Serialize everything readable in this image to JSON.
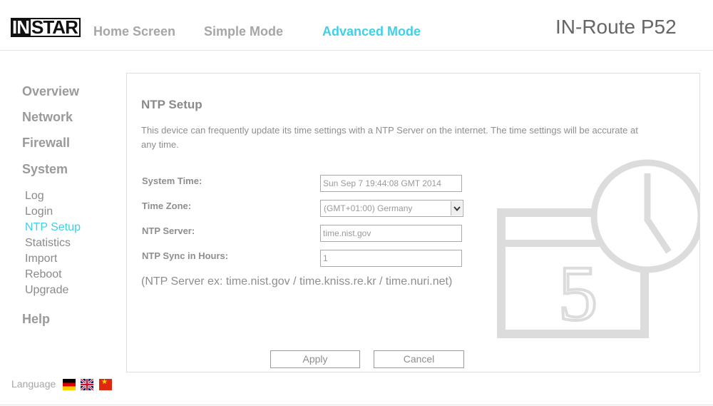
{
  "brand": {
    "logo_left": "IN",
    "logo_right": "STAR"
  },
  "topnav": {
    "home": "Home Screen",
    "simple": "Simple Mode",
    "advanced": "Advanced Mode"
  },
  "model": "IN-Route P52",
  "sidebar": {
    "overview": "Overview",
    "network": "Network",
    "firewall": "Firewall",
    "system": "System",
    "help": "Help",
    "sub": {
      "log": "Log",
      "login": "Login",
      "ntp": "NTP Setup",
      "statistics": "Statistics",
      "import": "Import",
      "reboot": "Reboot",
      "upgrade": "Upgrade"
    }
  },
  "language": {
    "label": "Language"
  },
  "panel": {
    "title": "NTP Setup",
    "description": "This device can frequently update its time settings with a NTP Server on the internet. The time settings will be accurate at any time.",
    "fields": {
      "system_time": {
        "label": "System Time:",
        "value": "Sun Sep  7 19:44:08 GMT 2014"
      },
      "time_zone": {
        "label": "Time Zone:",
        "value": "(GMT+01:00) Germany"
      },
      "ntp_server": {
        "label": "NTP Server:",
        "value": "time.nist.gov"
      },
      "ntp_sync": {
        "label": "NTP Sync in Hours:",
        "value": "1"
      }
    },
    "example": "(NTP Server ex: time.nist.gov / time.kniss.re.kr / time.nuri.net)",
    "apply": "Apply",
    "cancel": "Cancel",
    "deco_digit": "5"
  },
  "colors": {
    "accent": "#3fd0e8",
    "text": "#8e8e8e",
    "border": "#dedede"
  },
  "icons": [
    "clock-calendar-watermark",
    "flag-de-icon",
    "flag-uk-icon",
    "flag-cn-icon",
    "chevron-down-icon"
  ]
}
